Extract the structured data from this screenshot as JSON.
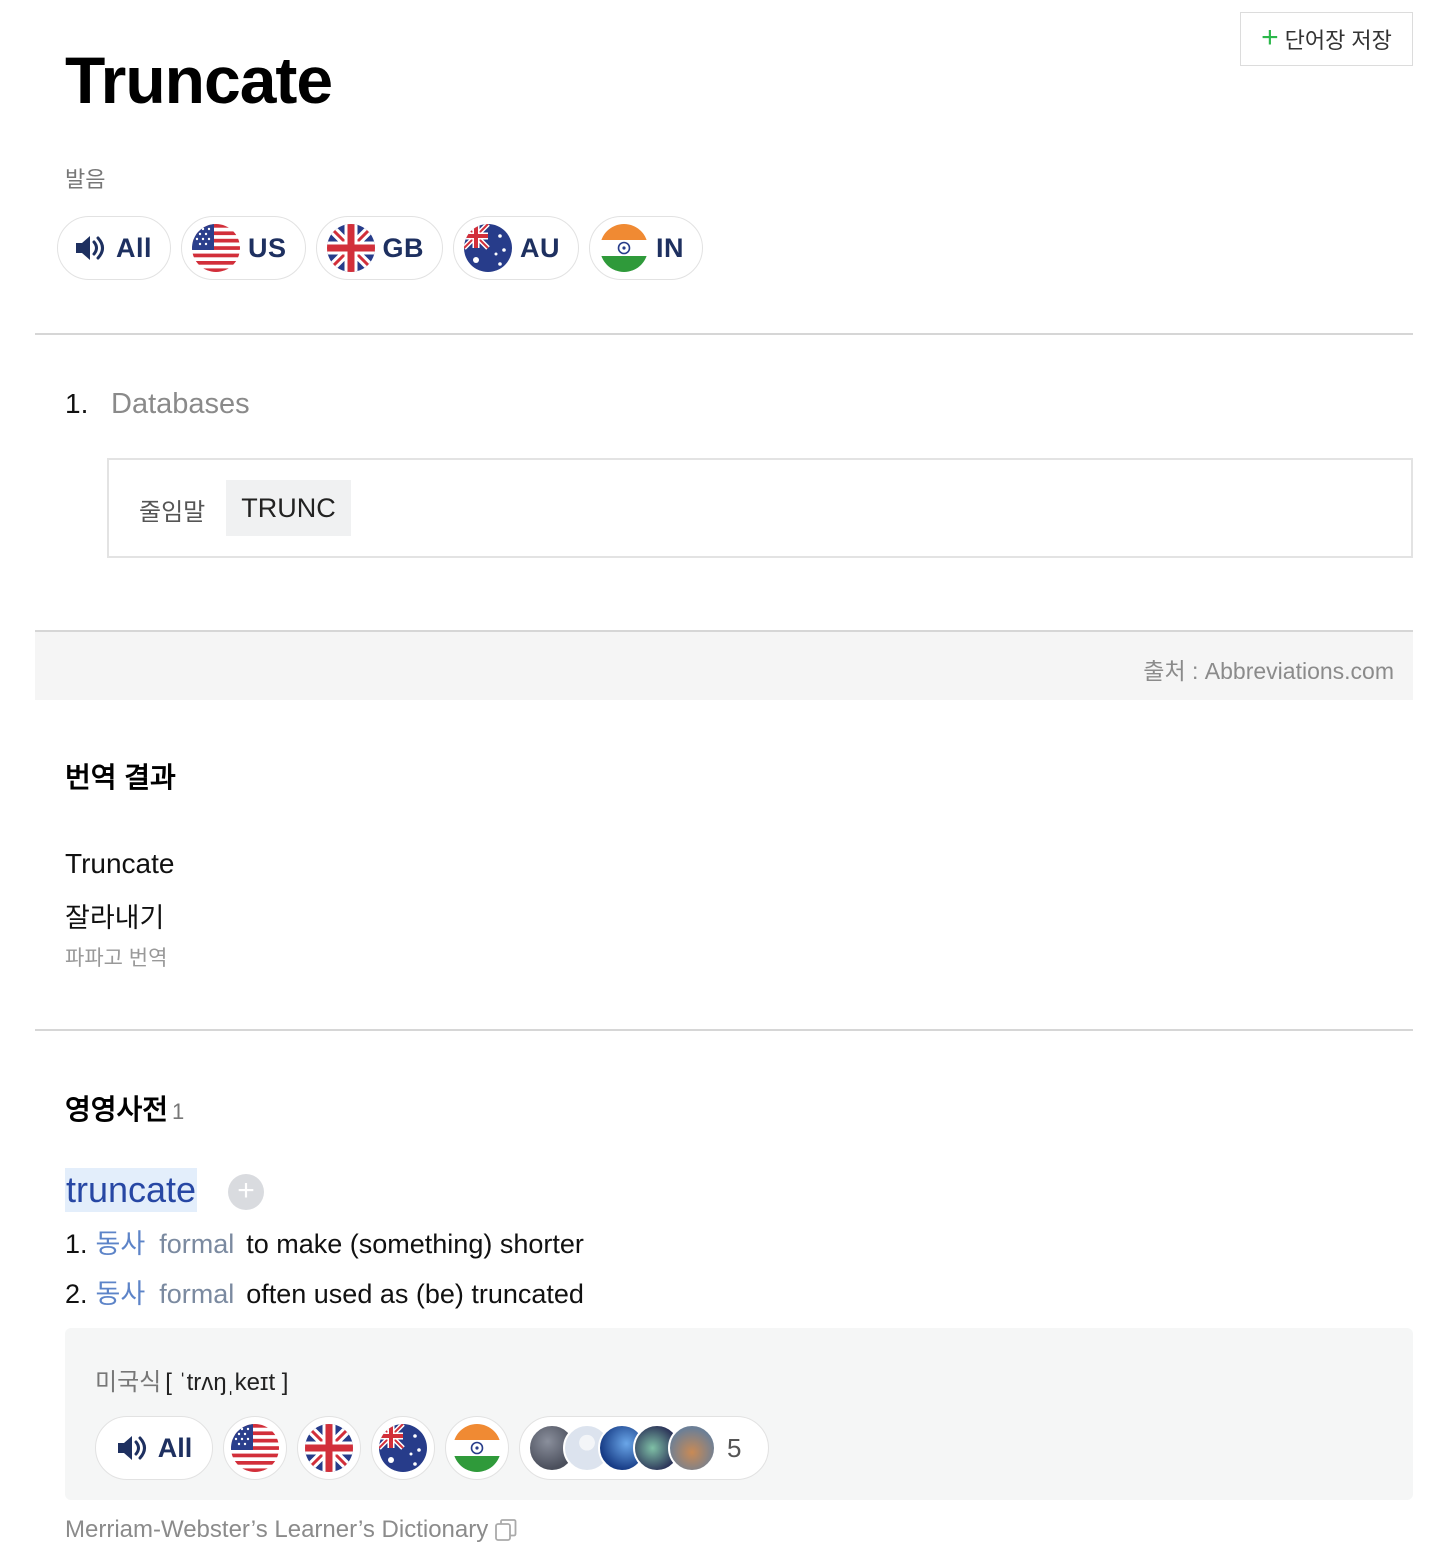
{
  "header": {
    "save_button_label": "단어장 저장",
    "word": "Truncate",
    "pronunciation_label": "발음",
    "pronunciation_buttons": [
      "All",
      "US",
      "GB",
      "AU",
      "IN"
    ]
  },
  "abbreviation_section": {
    "number": "1.",
    "category": "Databases",
    "abbr_label": "줄임말",
    "abbr_value": "TRUNC",
    "source": "출처 : Abbreviations.com"
  },
  "translation_section": {
    "title": "번역 결과",
    "source_text": "Truncate",
    "translated_text": "잘라내기",
    "provider": "파파고 번역"
  },
  "english_dictionary": {
    "title": "영영사전",
    "count": "1",
    "entry_word": "truncate",
    "senses": [
      {
        "num": "1.",
        "pos": "동사",
        "register": "formal",
        "definition": "to make (something) shorter"
      },
      {
        "num": "2.",
        "pos": "동사",
        "register": "formal",
        "definition": "often used as (be) truncated"
      }
    ],
    "phonetic_label": "미국식",
    "phonetic": "[ ˈtrʌŋˌkeɪt ]",
    "all_label": "All",
    "user_recordings_count": "5",
    "source": "Merriam-Webster’s Learner’s Dictionary"
  },
  "icons": {
    "plus": "plus-icon",
    "speaker": "speaker-icon",
    "flags": [
      "us-flag-icon",
      "gb-flag-icon",
      "au-flag-icon",
      "in-flag-icon"
    ],
    "copy": "copy-icon"
  },
  "colors": {
    "accent_green": "#2cb84b",
    "pill_label": "#1e3060",
    "entry_link": "#2747a4",
    "pos_blue": "#5d84c8"
  }
}
